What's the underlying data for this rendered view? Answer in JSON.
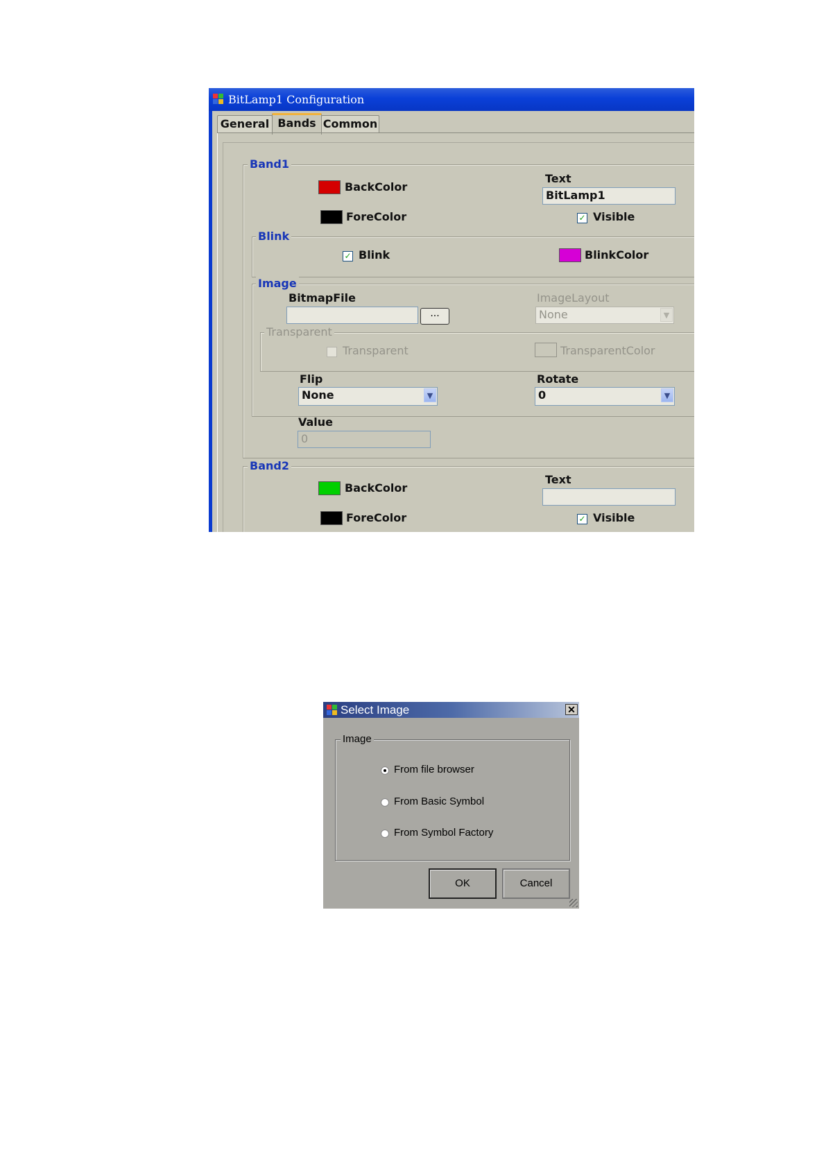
{
  "config_window": {
    "title": "BitLamp1 Configuration",
    "tabs": [
      {
        "label": "General"
      },
      {
        "label": "Bands",
        "active": true
      },
      {
        "label": "Common"
      }
    ],
    "band1": {
      "group_label": "Band1",
      "backcolor_label": "BackColor",
      "backcolor": "#d40000",
      "forecolor_label": "ForeColor",
      "forecolor": "#000000",
      "text_label": "Text",
      "text_value": "BitLamp1",
      "visible_label": "Visible",
      "visible_checked": true,
      "blink": {
        "group_label": "Blink",
        "blink_label": "Blink",
        "blink_checked": true,
        "blinkcolor_label": "BlinkColor",
        "blinkcolor": "#d600d6"
      },
      "image": {
        "group_label": "Image",
        "bitmapfile_label": "BitmapFile",
        "bitmapfile_value": "",
        "browse_label": "...",
        "imagelayout_label": "ImageLayout",
        "imagelayout_value": "None",
        "transparent_group_label": "Transparent",
        "transparent_label": "Transparent",
        "transparent_checked": false,
        "transparentcolor_label": "TransparentColor",
        "flip_label": "Flip",
        "flip_value": "None",
        "rotate_label": "Rotate",
        "rotate_value": "0"
      },
      "value_label": "Value",
      "value_value": "0"
    },
    "band2": {
      "group_label": "Band2",
      "backcolor_label": "BackColor",
      "backcolor": "#00d000",
      "forecolor_label": "ForeColor",
      "forecolor": "#000000",
      "text_label": "Text",
      "text_value": "",
      "visible_label": "Visible",
      "visible_checked": true
    }
  },
  "select_image_dialog": {
    "title": "Select Image",
    "group_label": "Image",
    "options": [
      {
        "label": "From file browser",
        "selected": true
      },
      {
        "label": "From Basic Symbol",
        "selected": false
      },
      {
        "label": "From Symbol Factory",
        "selected": false
      }
    ],
    "ok_label": "OK",
    "cancel_label": "Cancel"
  },
  "icons": [
    "app-icon",
    "checkmark-icon",
    "dropdown-arrow-icon",
    "close-icon",
    "resize-grip-icon"
  ]
}
